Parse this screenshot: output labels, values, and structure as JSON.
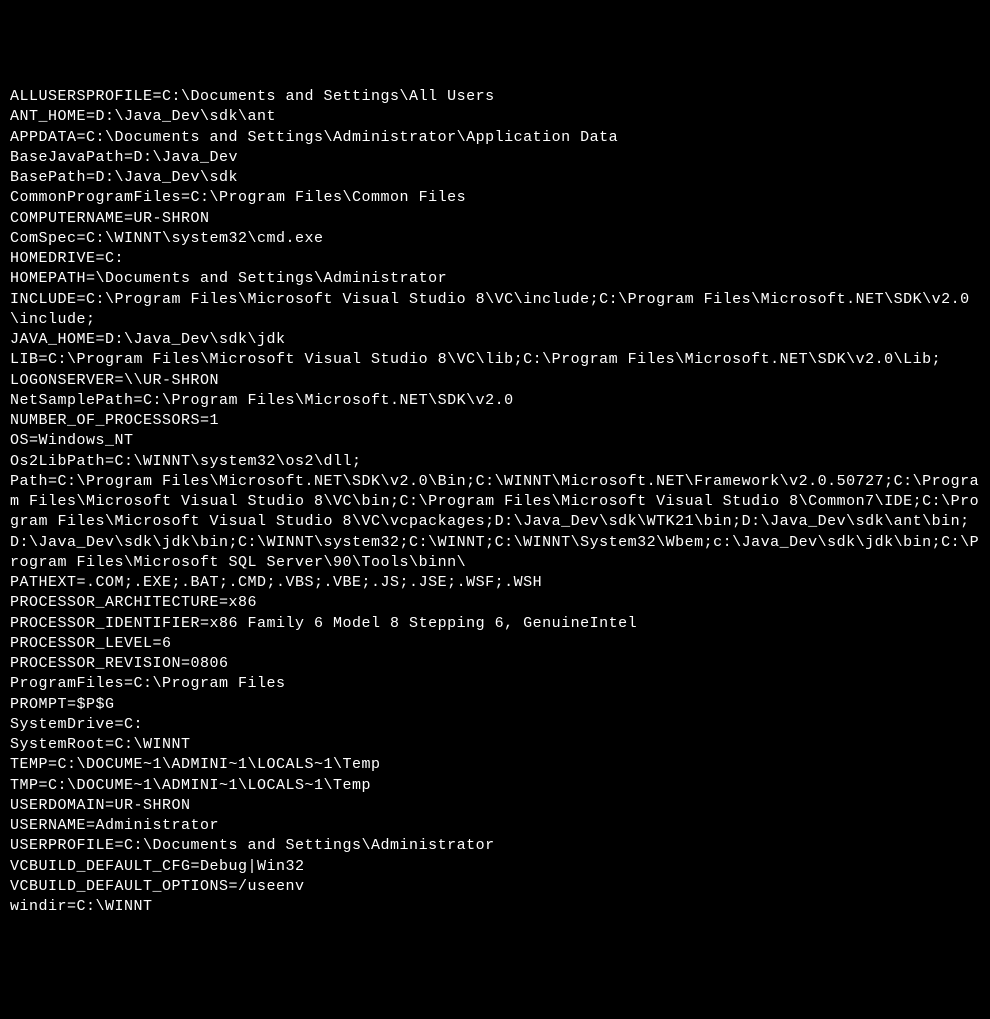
{
  "terminal": {
    "lines": [
      "ALLUSERSPROFILE=C:\\Documents and Settings\\All Users",
      "ANT_HOME=D:\\Java_Dev\\sdk\\ant",
      "APPDATA=C:\\Documents and Settings\\Administrator\\Application Data",
      "BaseJavaPath=D:\\Java_Dev",
      "BasePath=D:\\Java_Dev\\sdk",
      "CommonProgramFiles=C:\\Program Files\\Common Files",
      "COMPUTERNAME=UR-SHRON",
      "ComSpec=C:\\WINNT\\system32\\cmd.exe",
      "HOMEDRIVE=C:",
      "HOMEPATH=\\Documents and Settings\\Administrator",
      "INCLUDE=C:\\Program Files\\Microsoft Visual Studio 8\\VC\\include;C:\\Program Files\\Microsoft.NET\\SDK\\v2.0\\include;",
      "JAVA_HOME=D:\\Java_Dev\\sdk\\jdk",
      "LIB=C:\\Program Files\\Microsoft Visual Studio 8\\VC\\lib;C:\\Program Files\\Microsoft.NET\\SDK\\v2.0\\Lib;",
      "LOGONSERVER=\\\\UR-SHRON",
      "NetSamplePath=C:\\Program Files\\Microsoft.NET\\SDK\\v2.0",
      "NUMBER_OF_PROCESSORS=1",
      "OS=Windows_NT",
      "Os2LibPath=C:\\WINNT\\system32\\os2\\dll;",
      "Path=C:\\Program Files\\Microsoft.NET\\SDK\\v2.0\\Bin;C:\\WINNT\\Microsoft.NET\\Framework\\v2.0.50727;C:\\Program Files\\Microsoft Visual Studio 8\\VC\\bin;C:\\Program Files\\Microsoft Visual Studio 8\\Common7\\IDE;C:\\Program Files\\Microsoft Visual Studio 8\\VC\\vcpackages;D:\\Java_Dev\\sdk\\WTK21\\bin;D:\\Java_Dev\\sdk\\ant\\bin;D:\\Java_Dev\\sdk\\jdk\\bin;C:\\WINNT\\system32;C:\\WINNT;C:\\WINNT\\System32\\Wbem;c:\\Java_Dev\\sdk\\jdk\\bin;C:\\Program Files\\Microsoft SQL Server\\90\\Tools\\binn\\",
      "PATHEXT=.COM;.EXE;.BAT;.CMD;.VBS;.VBE;.JS;.JSE;.WSF;.WSH",
      "PROCESSOR_ARCHITECTURE=x86",
      "PROCESSOR_IDENTIFIER=x86 Family 6 Model 8 Stepping 6, GenuineIntel",
      "PROCESSOR_LEVEL=6",
      "PROCESSOR_REVISION=0806",
      "ProgramFiles=C:\\Program Files",
      "PROMPT=$P$G",
      "SystemDrive=C:",
      "SystemRoot=C:\\WINNT",
      "TEMP=C:\\DOCUME~1\\ADMINI~1\\LOCALS~1\\Temp",
      "TMP=C:\\DOCUME~1\\ADMINI~1\\LOCALS~1\\Temp",
      "USERDOMAIN=UR-SHRON",
      "USERNAME=Administrator",
      "USERPROFILE=C:\\Documents and Settings\\Administrator",
      "VCBUILD_DEFAULT_CFG=Debug|Win32",
      "VCBUILD_DEFAULT_OPTIONS=/useenv",
      "windir=C:\\WINNT"
    ]
  }
}
